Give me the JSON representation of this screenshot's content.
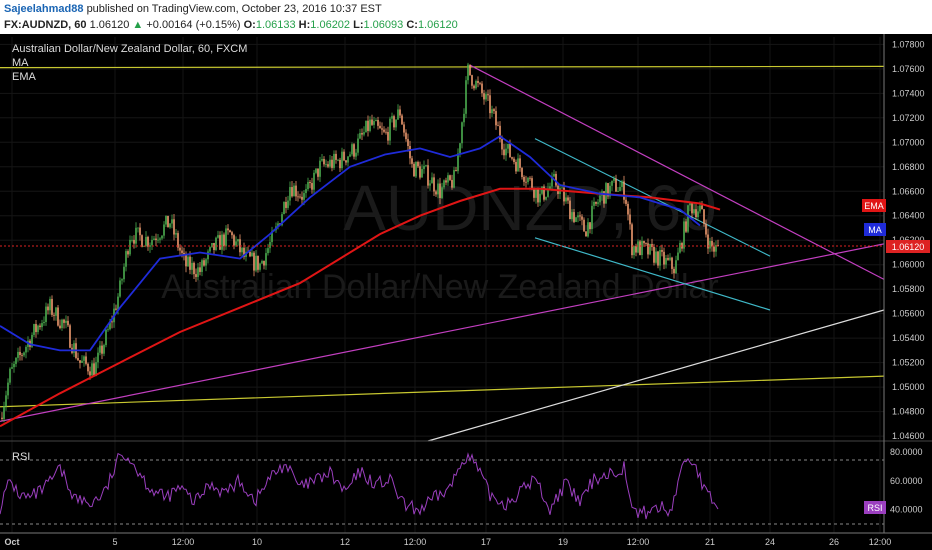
{
  "header": {
    "author": "Sajeelahmad88",
    "published_text": "published on TradingView.com, October 23, 2016 10:37 EST",
    "symbol": "FX:AUDNZD, 60",
    "last": "1.06120",
    "change_arrow": "▲",
    "change": "+0.00164 (+0.15%)",
    "o_label": "O:",
    "o": "1.06133",
    "h_label": "H:",
    "h": "1.06202",
    "l_label": "L:",
    "l": "1.06093",
    "c_label": "C:",
    "c": "1.06120"
  },
  "legend": {
    "title": "Australian Dollar/New Zealand Dollar, 60, FXCM",
    "ind1": "MA",
    "ind2": "EMA"
  },
  "watermark": {
    "line1": "AUDNZD, 60",
    "line2": "Australian Dollar/New Zealand Dollar"
  },
  "colors": {
    "up": "#4caf50",
    "down": "#ef9a6f",
    "ma": "#1f2bd9",
    "ema": "#e01515",
    "rsi": "#9b3fbf",
    "magenta": "#c23fc0",
    "cyan": "#3fb8c8",
    "yellow": "#c8c830"
  },
  "chart_data": {
    "type": "candlestick",
    "price_axis": [
      "1.07800",
      "1.07600",
      "1.07400",
      "1.07200",
      "1.07000",
      "1.06800",
      "1.06600",
      "1.06400",
      "1.06200",
      "1.06000",
      "1.05800",
      "1.05600",
      "1.05400",
      "1.05200",
      "1.05000",
      "1.04800",
      "1.04600"
    ],
    "price_range": [
      1.0456,
      1.0786
    ],
    "time_axis": [
      "Oct",
      "5",
      "12:00",
      "10",
      "12",
      "12:00",
      "17",
      "19",
      "12:00",
      "21",
      "24",
      "26",
      "12:00"
    ],
    "badges": {
      "ema": "EMA",
      "ma": "MA",
      "price": "1.06120",
      "rsi": "RSI"
    },
    "rsi_panel": {
      "label": "RSI",
      "axis": [
        "80.0000",
        "60.0000",
        "40.0000"
      ],
      "range": [
        26,
        84
      ],
      "bands": [
        70,
        30
      ]
    },
    "close_path": [
      [
        0,
        1.0475
      ],
      [
        10,
        1.051
      ],
      [
        30,
        1.054
      ],
      [
        50,
        1.0565
      ],
      [
        65,
        1.055
      ],
      [
        80,
        1.052
      ],
      [
        95,
        1.0515
      ],
      [
        110,
        1.055
      ],
      [
        120,
        1.058
      ],
      [
        130,
        1.0625
      ],
      [
        150,
        1.062
      ],
      [
        170,
        1.0635
      ],
      [
        185,
        1.06
      ],
      [
        200,
        1.0595
      ],
      [
        215,
        1.0615
      ],
      [
        230,
        1.0625
      ],
      [
        245,
        1.0605
      ],
      [
        260,
        1.06
      ],
      [
        275,
        1.0625
      ],
      [
        290,
        1.0665
      ],
      [
        305,
        1.0655
      ],
      [
        320,
        1.068
      ],
      [
        340,
        1.0685
      ],
      [
        355,
        1.0695
      ],
      [
        370,
        1.0715
      ],
      [
        385,
        1.0705
      ],
      [
        400,
        1.0725
      ],
      [
        412,
        1.068
      ],
      [
        425,
        1.0675
      ],
      [
        440,
        1.066
      ],
      [
        455,
        1.067
      ],
      [
        468,
        1.0758
      ],
      [
        478,
        1.0745
      ],
      [
        490,
        1.0728
      ],
      [
        505,
        1.0695
      ],
      [
        520,
        1.068
      ],
      [
        540,
        1.0655
      ],
      [
        555,
        1.0668
      ],
      [
        570,
        1.0645
      ],
      [
        585,
        1.0628
      ],
      [
        600,
        1.0655
      ],
      [
        615,
        1.0665
      ],
      [
        625,
        1.066
      ],
      [
        632,
        1.0615
      ],
      [
        645,
        1.0612
      ],
      [
        660,
        1.0605
      ],
      [
        675,
        1.0597
      ],
      [
        690,
        1.0648
      ],
      [
        700,
        1.0645
      ],
      [
        710,
        1.0615
      ],
      [
        718,
        1.0612
      ]
    ],
    "ma_path": [
      [
        0,
        1.055
      ],
      [
        30,
        1.0535
      ],
      [
        60,
        1.053
      ],
      [
        90,
        1.053
      ],
      [
        120,
        1.0565
      ],
      [
        160,
        1.0605
      ],
      [
        200,
        1.061
      ],
      [
        240,
        1.0605
      ],
      [
        270,
        1.0625
      ],
      [
        310,
        1.0655
      ],
      [
        350,
        1.068
      ],
      [
        385,
        1.069
      ],
      [
        420,
        1.0695
      ],
      [
        450,
        1.0688
      ],
      [
        480,
        1.0695
      ],
      [
        500,
        1.0705
      ],
      [
        530,
        1.0688
      ],
      [
        560,
        1.0665
      ],
      [
        600,
        1.0658
      ],
      [
        640,
        1.0655
      ],
      [
        680,
        1.0645
      ],
      [
        700,
        1.0632
      ]
    ],
    "ema_path": [
      [
        0,
        1.0468
      ],
      [
        60,
        1.0495
      ],
      [
        120,
        1.052
      ],
      [
        180,
        1.0545
      ],
      [
        240,
        1.0565
      ],
      [
        300,
        1.0585
      ],
      [
        340,
        1.0605
      ],
      [
        380,
        1.0625
      ],
      [
        420,
        1.064
      ],
      [
        460,
        1.0652
      ],
      [
        500,
        1.0662
      ],
      [
        540,
        1.0662
      ],
      [
        600,
        1.0658
      ],
      [
        650,
        1.0655
      ],
      [
        700,
        1.065
      ],
      [
        720,
        1.0645
      ]
    ],
    "trendlines": [
      {
        "p1": [
          0,
          1.0484
        ],
        "p2": [
          884,
          1.0509
        ],
        "color": "yellow"
      },
      {
        "p1": [
          0,
          1.0761
        ],
        "p2": [
          884,
          1.0762
        ],
        "color": "yellow"
      },
      {
        "p1": [
          0,
          1.0472
        ],
        "p2": [
          884,
          1.0617
        ],
        "color": "magenta"
      },
      {
        "p1": [
          470,
          1.0763
        ],
        "p2": [
          884,
          1.0588
        ],
        "color": "magenta"
      },
      {
        "p1": [
          535,
          1.0703
        ],
        "p2": [
          770,
          1.0607
        ],
        "color": "cyan"
      },
      {
        "p1": [
          535,
          1.0622
        ],
        "p2": [
          770,
          1.0563
        ],
        "color": "cyan"
      },
      {
        "p1": [
          428,
          1.0456
        ],
        "p2": [
          884,
          1.0563
        ],
        "color": "white"
      }
    ],
    "rsi_path": [
      [
        0,
        42
      ],
      [
        10,
        60
      ],
      [
        20,
        50
      ],
      [
        30,
        48
      ],
      [
        45,
        55
      ],
      [
        60,
        68
      ],
      [
        75,
        48
      ],
      [
        90,
        44
      ],
      [
        105,
        52
      ],
      [
        118,
        74
      ],
      [
        125,
        80
      ],
      [
        135,
        70
      ],
      [
        150,
        55
      ],
      [
        165,
        48
      ],
      [
        180,
        55
      ],
      [
        195,
        45
      ],
      [
        210,
        58
      ],
      [
        225,
        52
      ],
      [
        240,
        60
      ],
      [
        255,
        46
      ],
      [
        270,
        62
      ],
      [
        285,
        72
      ],
      [
        300,
        55
      ],
      [
        315,
        60
      ],
      [
        330,
        65
      ],
      [
        345,
        52
      ],
      [
        360,
        66
      ],
      [
        375,
        58
      ],
      [
        390,
        60
      ],
      [
        405,
        42
      ],
      [
        420,
        40
      ],
      [
        435,
        48
      ],
      [
        450,
        55
      ],
      [
        465,
        78
      ],
      [
        475,
        72
      ],
      [
        490,
        50
      ],
      [
        505,
        44
      ],
      [
        520,
        52
      ],
      [
        535,
        62
      ],
      [
        550,
        40
      ],
      [
        565,
        58
      ],
      [
        580,
        45
      ],
      [
        595,
        62
      ],
      [
        610,
        65
      ],
      [
        625,
        70
      ],
      [
        632,
        38
      ],
      [
        645,
        38
      ],
      [
        660,
        42
      ],
      [
        670,
        38
      ],
      [
        685,
        76
      ],
      [
        695,
        72
      ],
      [
        705,
        52
      ],
      [
        718,
        42
      ]
    ]
  }
}
